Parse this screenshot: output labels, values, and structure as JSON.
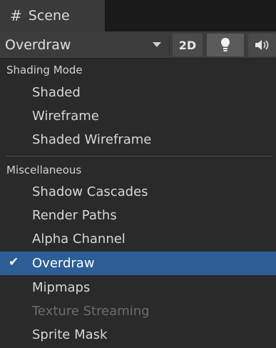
{
  "tab": {
    "icon": "hash-icon",
    "title": "Scene"
  },
  "toolbar": {
    "draw_mode": "Overdraw",
    "btn_2d": "2D",
    "lighting_icon": "lightbulb-icon",
    "audio_icon": "speaker-icon"
  },
  "menu": {
    "section1": {
      "header": "Shading Mode",
      "items": [
        "Shaded",
        "Wireframe",
        "Shaded Wireframe"
      ]
    },
    "section2": {
      "header": "Miscellaneous",
      "items": [
        {
          "label": "Shadow Cascades",
          "state": "normal"
        },
        {
          "label": "Render Paths",
          "state": "normal"
        },
        {
          "label": "Alpha Channel",
          "state": "normal"
        },
        {
          "label": "Overdraw",
          "state": "selected"
        },
        {
          "label": "Mipmaps",
          "state": "normal"
        },
        {
          "label": "Texture Streaming",
          "state": "disabled"
        },
        {
          "label": "Sprite Mask",
          "state": "normal"
        }
      ]
    },
    "check_glyph": "✔"
  },
  "colors": {
    "selected_bg": "#2d5e96",
    "menu_bg": "#2a2a2a",
    "toolbar_bg": "#3c3c3c"
  }
}
